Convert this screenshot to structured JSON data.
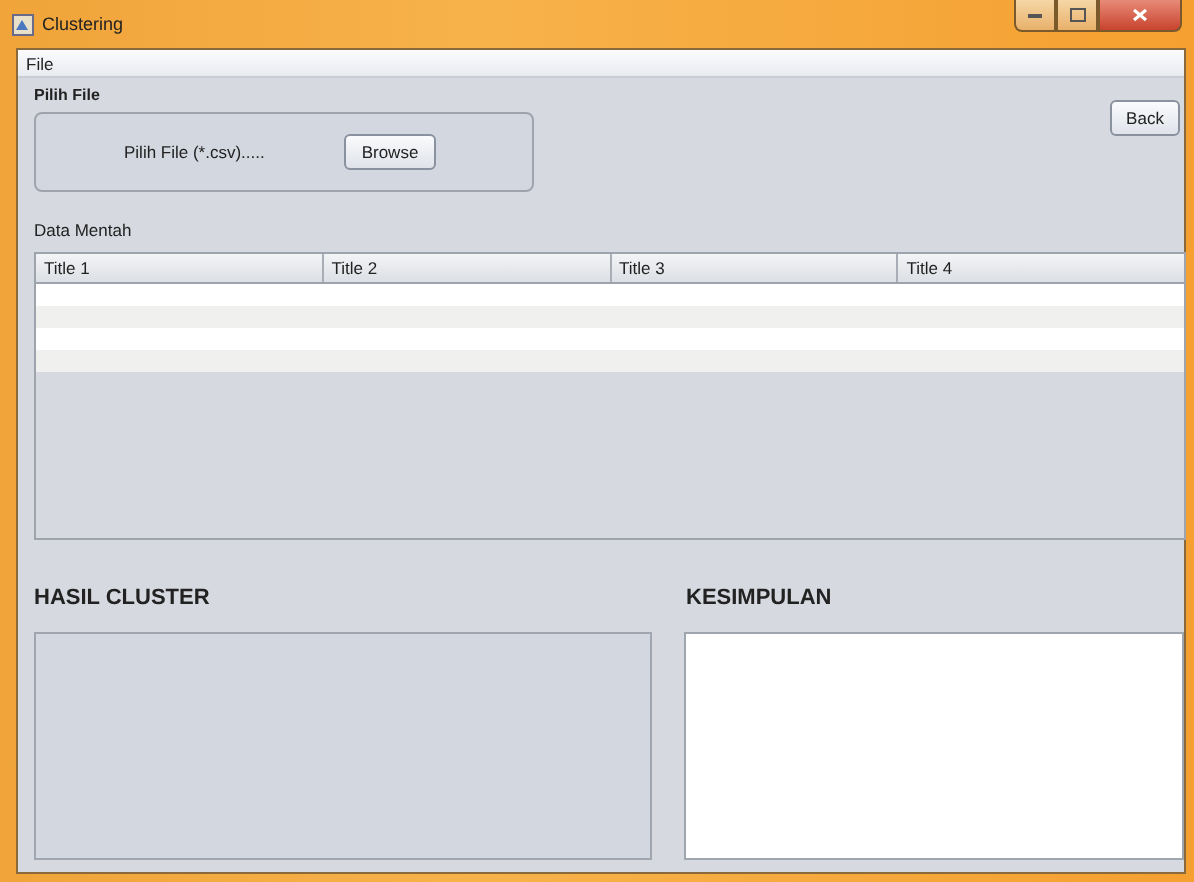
{
  "window": {
    "title": "Clustering"
  },
  "menu": [
    "File"
  ],
  "file_panel": {
    "title": "Pilih File",
    "label": "Pilih File (*.csv).....",
    "button": "Browse"
  },
  "back_button": "Back",
  "data_panel": {
    "title": "Data Mentah",
    "columns": [
      "Title 1",
      "Title 2",
      "Title 3",
      "Title 4"
    ]
  },
  "result_panel": {
    "title": "HASIL CLUSTER"
  },
  "conclusion_panel": {
    "title": "KESIMPULAN"
  }
}
